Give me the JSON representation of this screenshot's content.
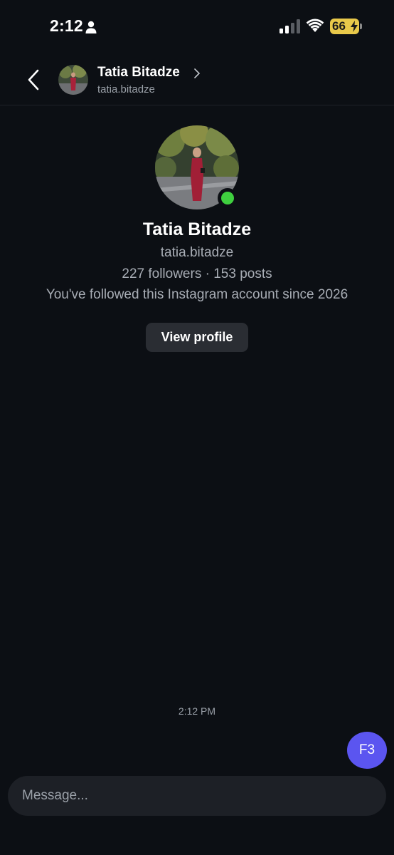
{
  "status_bar": {
    "time": "2:12",
    "battery": "66",
    "icons": [
      "person-icon",
      "signal-icon",
      "wifi-icon",
      "battery-charging-icon"
    ]
  },
  "header": {
    "name": "Tatia Bitadze",
    "handle": "tatia.bitadze"
  },
  "profile": {
    "name": "Tatia Bitadze",
    "handle": "tatia.bitadze",
    "stats": "227 followers · 153 posts",
    "follow_note": "You've followed this Instagram account since 2026",
    "view_profile_label": "View profile",
    "online": true
  },
  "conversation": {
    "timestamp": "2:12 PM",
    "sent_message": "F3"
  },
  "composer": {
    "placeholder": "Message..."
  },
  "colors": {
    "background": "#0c0f14",
    "online": "#3fcf3f",
    "sent_bubble": "#5b55f0",
    "battery": "#e9c94a"
  }
}
